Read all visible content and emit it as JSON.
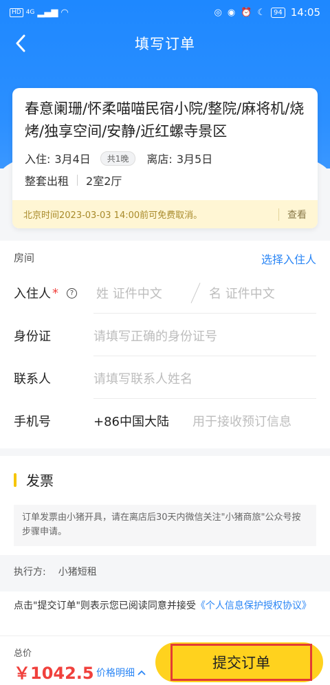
{
  "status": {
    "carrier": "HD",
    "network": "4G",
    "battery": "94",
    "time": "14:05"
  },
  "nav": {
    "title": "填写订单"
  },
  "listing": {
    "title": "春意阑珊/怀柔喵喵民宿小院/整院/麻将机/烧烤/独享空间/安静/近红螺寺景区",
    "checkin_label": "入住:",
    "checkin_date": "3月4日",
    "nights": "共1晚",
    "checkout_label": "离店:",
    "checkout_date": "3月5日",
    "rent_type": "整套出租",
    "layout": "2室2厅",
    "cancel_policy": "北京时间2023-03-03 14:00前可免费取消。",
    "view_label": "查看"
  },
  "form": {
    "room_label": "房间",
    "pick_guest": "选择入住人",
    "guest_label": "入住人",
    "required_mark": "*",
    "last_name_placeholder": "姓 证件中文",
    "first_name_placeholder": "名 证件中文",
    "id_label": "身份证",
    "id_placeholder": "请填写正确的身份证号",
    "contact_label": "联系人",
    "contact_placeholder": "请填写联系人姓名",
    "phone_label": "手机号",
    "country_code": "+86中国大陆",
    "phone_placeholder": "用于接收预订信息"
  },
  "invoice": {
    "title": "发票",
    "note": "订单发票由小猪开具，请在离店后30天内微信关注\"小猪商旅\"公众号按步骤申请。"
  },
  "executor": {
    "label": "执行方:",
    "value": "小猪短租"
  },
  "agreement": {
    "text": "点击\"提交订单\"则表示您已阅读同意并接受",
    "link": "《个人信息保护授权协议》"
  },
  "bottom": {
    "total_label": "总价",
    "price": "￥1042.5",
    "detail_label": "价格明细",
    "submit_label": "提交订单"
  },
  "colors": {
    "primary_blue": "#1e88ff",
    "accent_yellow": "#ffd21e",
    "price_red": "#f0403c",
    "link_blue": "#2b86f5"
  }
}
